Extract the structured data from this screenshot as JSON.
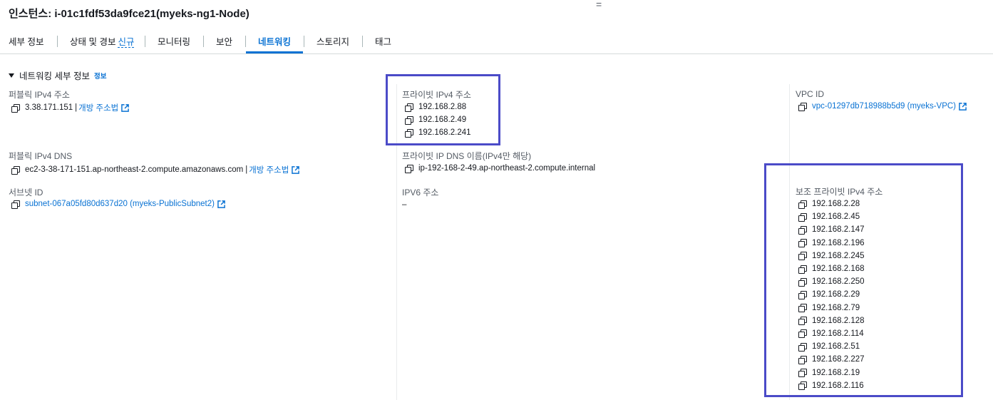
{
  "header": {
    "title": "인스턴스: i-01c1fdf53da9fce21(myeks-ng1-Node)",
    "handle": "="
  },
  "tabs": [
    {
      "label": "세부 정보"
    },
    {
      "label": "상태 및 경보",
      "badge": "신규"
    },
    {
      "label": "모니터링"
    },
    {
      "label": "보안"
    },
    {
      "label": "네트워킹",
      "active": true
    },
    {
      "label": "스토리지"
    },
    {
      "label": "태그"
    }
  ],
  "section": {
    "title": "네트워킹 세부 정보",
    "info": "정보"
  },
  "public_ipv4": {
    "label": "퍼블릭 IPv4 주소",
    "value": "3.38.171.151",
    "link": "개방 주소법"
  },
  "private_ipv4": {
    "label": "프라이빗 IPv4 주소",
    "values": [
      "192.168.2.88",
      "192.168.2.49",
      "192.168.2.241"
    ]
  },
  "vpc": {
    "label": "VPC ID",
    "value": "vpc-01297db718988b5d9 (myeks-VPC)"
  },
  "public_dns": {
    "label": "퍼블릭 IPv4 DNS",
    "value": "ec2-3-38-171-151.ap-northeast-2.compute.amazonaws.com",
    "link": "개방 주소법"
  },
  "private_dns": {
    "label": "프라이빗 IP DNS 이름(IPv4만 해당)",
    "value": "ip-192-168-2-49.ap-northeast-2.compute.internal"
  },
  "subnet": {
    "label": "서브넷 ID",
    "value": "subnet-067a05fd80d637d20 (myeks-PublicSubnet2)"
  },
  "ipv6": {
    "label": "IPV6 주소",
    "value": "–"
  },
  "secondary_ipv4": {
    "label": "보조 프라이빗 IPv4 주소",
    "values": [
      "192.168.2.28",
      "192.168.2.45",
      "192.168.2.147",
      "192.168.2.196",
      "192.168.2.245",
      "192.168.2.168",
      "192.168.2.250",
      "192.168.2.29",
      "192.168.2.79",
      "192.168.2.128",
      "192.168.2.114",
      "192.168.2.51",
      "192.168.2.227",
      "192.168.2.19",
      "192.168.2.116"
    ]
  },
  "colors": {
    "link": "#0972d3",
    "highlight": "#4b4bc8"
  }
}
